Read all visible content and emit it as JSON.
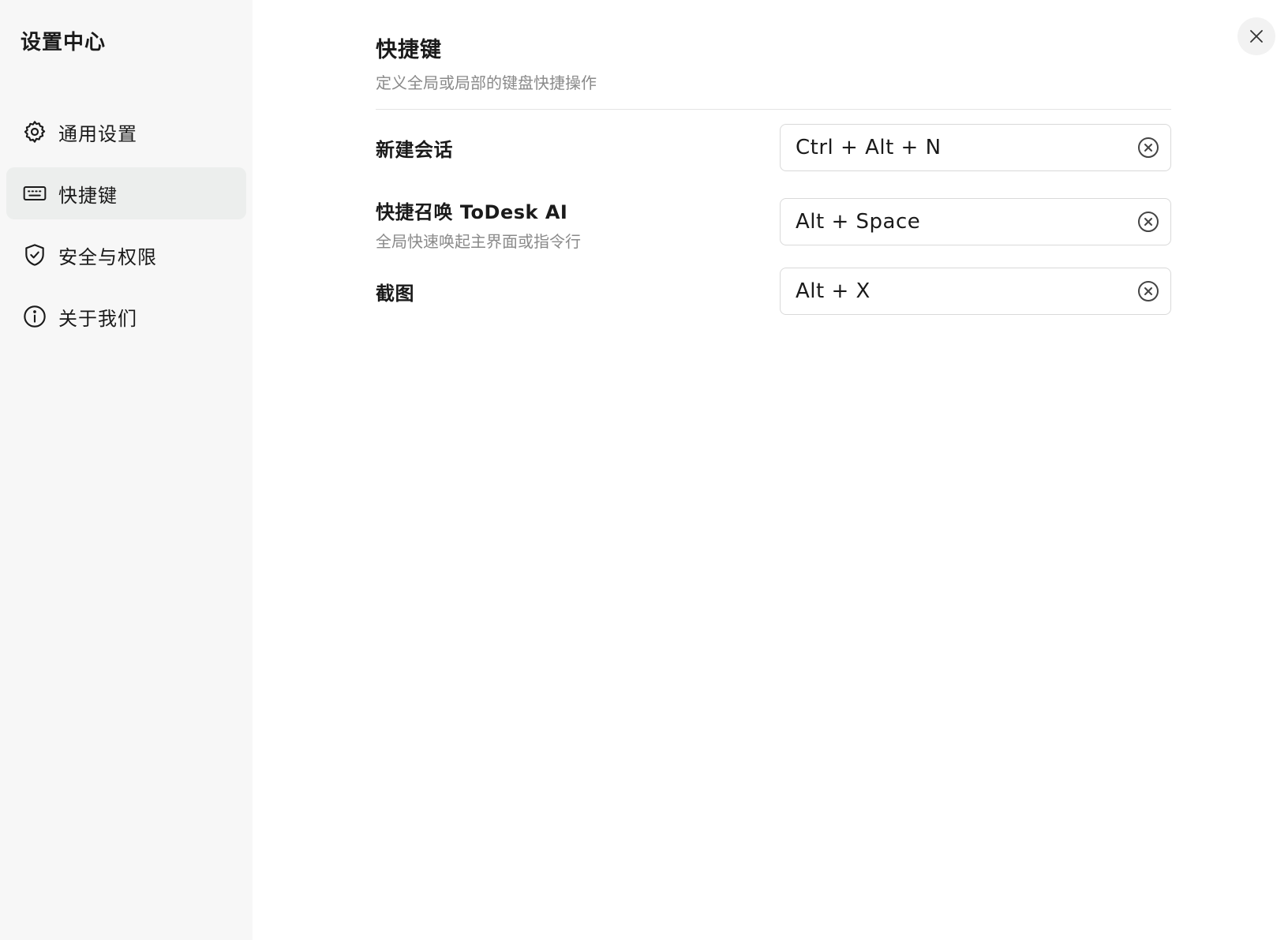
{
  "sidebar": {
    "title": "设置中心",
    "items": [
      {
        "label": "通用设置",
        "icon": "gear-icon",
        "active": false
      },
      {
        "label": "快捷键",
        "icon": "keyboard-icon",
        "active": true
      },
      {
        "label": "安全与权限",
        "icon": "shield-icon",
        "active": false
      },
      {
        "label": "关于我们",
        "icon": "info-icon",
        "active": false
      }
    ]
  },
  "main": {
    "title": "快捷键",
    "subtitle": "定义全局或局部的键盘快捷操作",
    "shortcuts": [
      {
        "label": "新建会话",
        "description": "",
        "keys": "Ctrl + Alt + N"
      },
      {
        "label": "快捷召唤 ToDesk AI",
        "description": "全局快速唤起主界面或指令行",
        "keys": "Alt + Space"
      },
      {
        "label": "截图",
        "description": "",
        "keys": "Alt + X"
      }
    ]
  },
  "colors": {
    "sidebar_bg": "#f7f7f7",
    "active_item_bg": "#eceeed",
    "muted_text": "#8a8a8a",
    "border": "#d9d9d9"
  }
}
